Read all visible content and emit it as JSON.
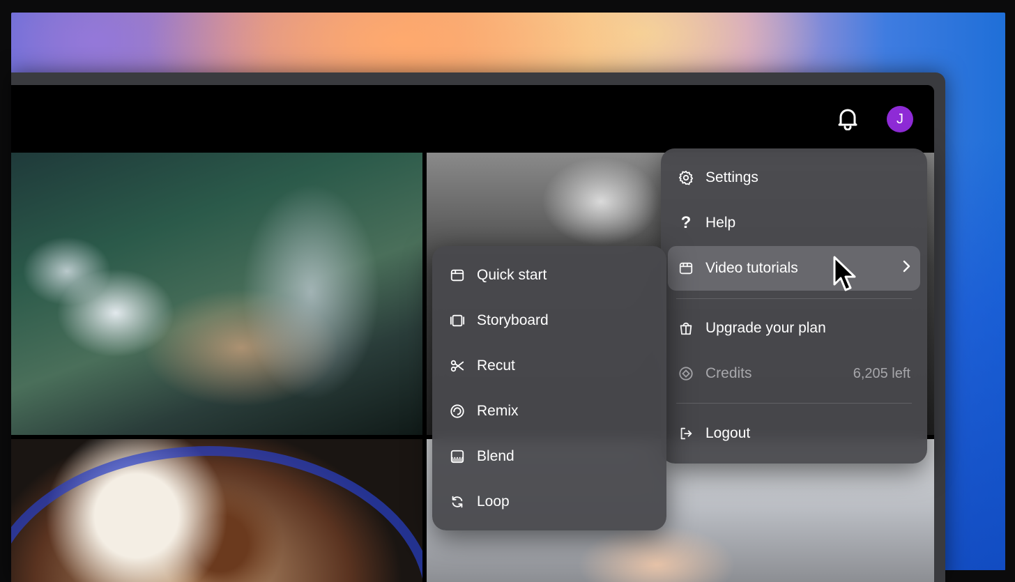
{
  "header": {
    "avatar_initial": "J",
    "avatar_color": "#8e2bd6"
  },
  "account_menu": {
    "items": [
      {
        "label": "Settings",
        "icon": "gear-icon"
      },
      {
        "label": "Help",
        "icon": "question-icon"
      },
      {
        "label": "Video tutorials",
        "icon": "video-icon",
        "has_submenu": true,
        "active": true
      },
      {
        "label": "Upgrade your plan",
        "icon": "gift-bag-icon"
      },
      {
        "label": "Credits",
        "icon": "credits-icon",
        "value": "6,205 left",
        "disabled": true
      },
      {
        "label": "Logout",
        "icon": "logout-icon"
      }
    ]
  },
  "tutorials_submenu": {
    "items": [
      {
        "label": "Quick start",
        "icon": "window-icon"
      },
      {
        "label": "Storyboard",
        "icon": "storyboard-icon"
      },
      {
        "label": "Recut",
        "icon": "scissors-icon"
      },
      {
        "label": "Remix",
        "icon": "remix-icon"
      },
      {
        "label": "Blend",
        "icon": "blend-icon"
      },
      {
        "label": "Loop",
        "icon": "loop-icon"
      }
    ]
  }
}
